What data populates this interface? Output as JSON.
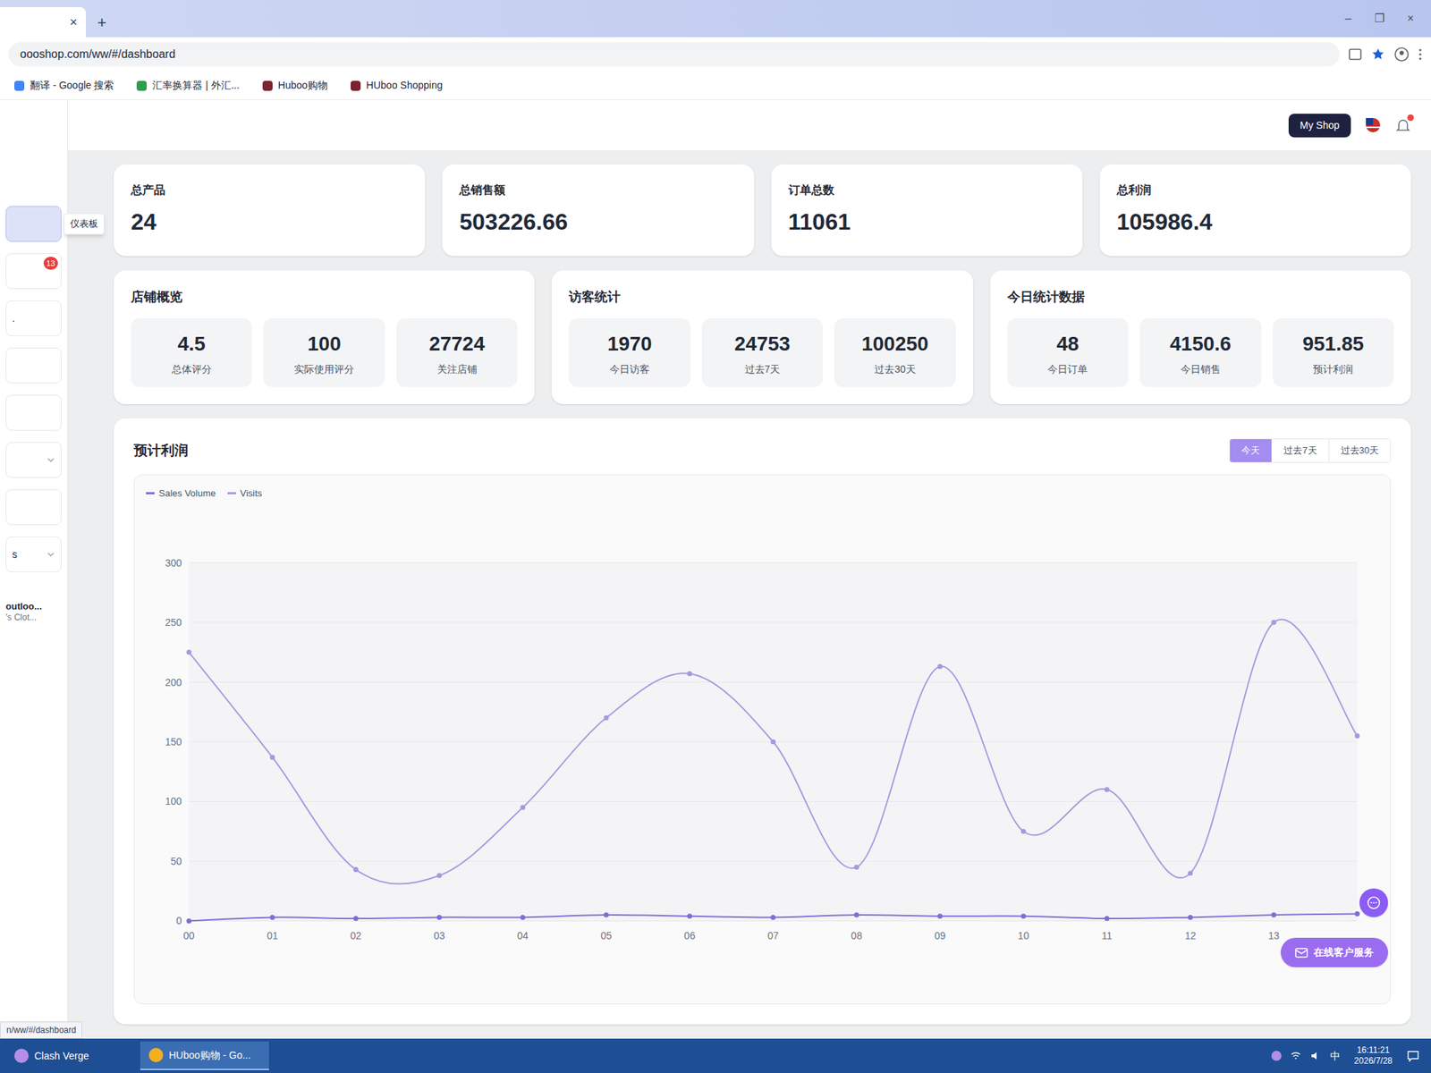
{
  "browser": {
    "tab_close": "×",
    "new_tab": "+",
    "url": "oooshop.com/ww/#/dashboard",
    "window_controls": [
      "–",
      "❐",
      "×"
    ],
    "bookmarks": [
      {
        "label": "翻译 - Google 搜索",
        "color": "#4285f4"
      },
      {
        "label": "汇率换算器 | 外汇...",
        "color": "#2e9e4f"
      },
      {
        "label": "Huboo购物",
        "color": "#7a2430"
      },
      {
        "label": "HUboo Shopping",
        "color": "#7a2430"
      }
    ]
  },
  "sidebar": {
    "tooltip": "仪表板",
    "items": [
      {
        "label": "",
        "selected": true,
        "badge": "",
        "kind": "plain"
      },
      {
        "label": "",
        "selected": false,
        "badge": "13",
        "kind": "plain"
      },
      {
        "label": ".",
        "selected": false,
        "badge": "",
        "kind": "plain"
      },
      {
        "label": "",
        "selected": false,
        "badge": "",
        "kind": "plain"
      },
      {
        "label": "",
        "selected": false,
        "badge": "",
        "kind": "plain"
      },
      {
        "label": "",
        "selected": false,
        "badge": "",
        "kind": "group"
      },
      {
        "label": "",
        "selected": false,
        "badge": "",
        "kind": "plain"
      },
      {
        "label": "s",
        "selected": false,
        "badge": "",
        "kind": "group"
      }
    ],
    "shop": {
      "name": "outloo...",
      "subtitle": "'s Clot..."
    }
  },
  "header": {
    "shop_button": "My Shop"
  },
  "stats": [
    {
      "label": "总产品",
      "value": "24"
    },
    {
      "label": "总销售额",
      "value": "503226.66"
    },
    {
      "label": "订单总数",
      "value": "11061"
    },
    {
      "label": "总利润",
      "value": "105986.4"
    }
  ],
  "panels": [
    {
      "title": "店铺概览",
      "items": [
        {
          "value": "4.5",
          "label": "总体评分"
        },
        {
          "value": "100",
          "label": "实际使用评分"
        },
        {
          "value": "27724",
          "label": "关注店铺"
        }
      ]
    },
    {
      "title": "访客统计",
      "items": [
        {
          "value": "1970",
          "label": "今日访客"
        },
        {
          "value": "24753",
          "label": "过去7天"
        },
        {
          "value": "100250",
          "label": "过去30天"
        }
      ]
    },
    {
      "title": "今日统计数据",
      "items": [
        {
          "value": "48",
          "label": "今日订单"
        },
        {
          "value": "4150.6",
          "label": "今日销售"
        },
        {
          "value": "951.85",
          "label": "预计利润"
        }
      ]
    }
  ],
  "chart": {
    "title": "预计利润",
    "ranges": [
      {
        "label": "今天",
        "selected": true
      },
      {
        "label": "过去7天",
        "selected": false
      },
      {
        "label": "过去30天",
        "selected": false
      }
    ],
    "y_ticks": [
      "300",
      "250",
      "200",
      "150",
      "100",
      "50",
      "0"
    ],
    "x_labels": [
      "00",
      "01",
      "02",
      "03",
      "04",
      "05",
      "06",
      "07",
      "08",
      "09",
      "10",
      "11",
      "12",
      "13"
    ],
    "series": [
      {
        "name": "Sales Volume",
        "color": "#7c6fd6",
        "values": [
          0,
          3,
          2,
          3,
          3,
          5,
          4,
          3,
          5,
          4,
          4,
          2,
          3,
          5,
          6
        ]
      },
      {
        "name": "Visits",
        "color": "#a59ae0",
        "values": [
          225,
          137,
          43,
          38,
          95,
          170,
          207,
          150,
          45,
          213,
          75,
          110,
          40,
          250,
          155
        ]
      }
    ]
  },
  "support": {
    "label": "在线客户服务"
  },
  "status_url": "n/ww/#/dashboard",
  "taskbar": {
    "apps": [
      {
        "label": "Clash Verge",
        "selected": false
      },
      {
        "label": "HUboo购物 - Go...",
        "selected": true
      }
    ],
    "ime": "中",
    "time": "16:11:21",
    "date": "2026/7/28"
  }
}
